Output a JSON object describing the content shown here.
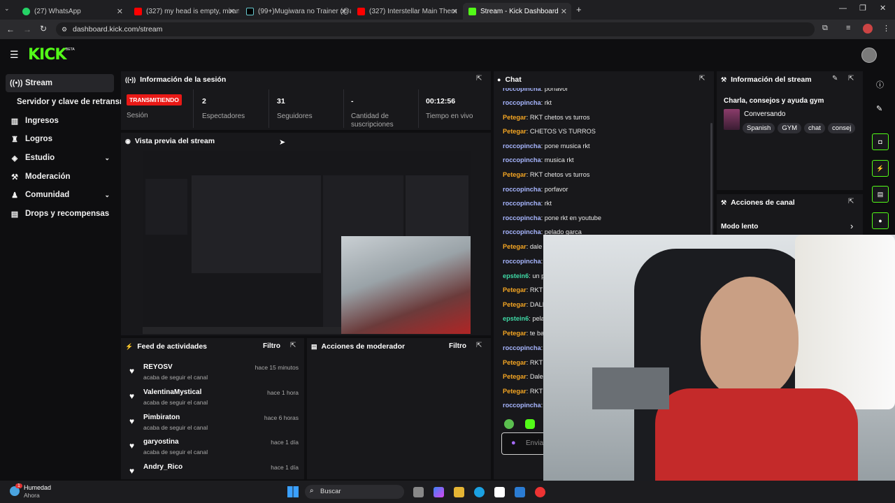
{
  "browser": {
    "tabs": [
      {
        "label": "(27) WhatsApp",
        "color": "#25d366"
      },
      {
        "label": "(327) my head is empty, mirand",
        "color": "#ff0000"
      },
      {
        "label": "(99+)Mugiwara no Trainer (@a",
        "color": "#000000"
      },
      {
        "label": "(327) Interstellar Main Them",
        "color": "#ff0000"
      },
      {
        "label": "Stream - Kick Dashboard",
        "color": "#53fc18"
      }
    ],
    "url": "dashboard.kick.com/stream"
  },
  "brand": {
    "logo": "KICK",
    "beta": "BETA",
    "accent": "#53fc18"
  },
  "sidebar": {
    "items": [
      {
        "label": "Stream",
        "icon": "broadcast-icon"
      },
      {
        "label": "Servidor y clave de retransm",
        "icon": ""
      },
      {
        "label": "Ingresos",
        "icon": "chart-icon"
      },
      {
        "label": "Logros",
        "icon": "trophy-icon"
      },
      {
        "label": "Estudio",
        "icon": "layers-icon"
      },
      {
        "label": "Moderación",
        "icon": "wrench-icon"
      },
      {
        "label": "Comunidad",
        "icon": "people-icon"
      },
      {
        "label": "Drops y recompensas",
        "icon": "gift-icon"
      }
    ]
  },
  "session": {
    "title": "Información de la sesión",
    "status_badge": "TRANSMITIENDO",
    "status_label": "Sesión",
    "stats": [
      {
        "value": "2",
        "label": "Espectadores"
      },
      {
        "value": "31",
        "label": "Seguidores"
      },
      {
        "value": "-",
        "label": "Cantidad de suscripciones"
      },
      {
        "value": "00:12:56",
        "label": "Tiempo en vivo"
      }
    ]
  },
  "preview": {
    "title": "Vista previa del stream"
  },
  "feed": {
    "title": "Feed de actividades",
    "filter": "Filtro",
    "rows": [
      {
        "name": "REYOSV",
        "sub": "acaba de seguir el canal",
        "time": "hace 15 minutos"
      },
      {
        "name": "ValentinaMystical",
        "sub": "acaba de seguir el canal",
        "time": "hace 1 hora"
      },
      {
        "name": "Pimbiraton",
        "sub": "acaba de seguir el canal",
        "time": "hace 6 horas"
      },
      {
        "name": "garyostina",
        "sub": "acaba de seguir el canal",
        "time": "hace 1 día"
      },
      {
        "name": "Andry_Rico",
        "sub": "",
        "time": "hace 1 día"
      }
    ]
  },
  "modactions": {
    "title": "Acciones de moderador",
    "filter": "Filtro"
  },
  "chat": {
    "title": "Chat",
    "input_placeholder": "Envia",
    "messages": [
      {
        "user": "roccopincha",
        "text": ": porfavor",
        "color": "#a7b6ff"
      },
      {
        "user": "roccopincha",
        "text": ": rkt",
        "color": "#a7b6ff"
      },
      {
        "user": "Petegar",
        "text": ": RKT chetos vs turros",
        "color": "#f5a623"
      },
      {
        "user": "Petegar",
        "text": ": CHETOS VS TURROS",
        "color": "#f5a623"
      },
      {
        "user": "roccopincha",
        "text": ": pone musica rkt",
        "color": "#a7b6ff"
      },
      {
        "user": "roccopincha",
        "text": ": musica rkt",
        "color": "#a7b6ff"
      },
      {
        "user": "Petegar",
        "text": ": RKT chetos vs turros",
        "color": "#f5a623"
      },
      {
        "user": "roccopincha",
        "text": ": porfavor",
        "color": "#a7b6ff"
      },
      {
        "user": "roccopincha",
        "text": ": rkt",
        "color": "#a7b6ff"
      },
      {
        "user": "roccopincha",
        "text": ": pone rkt en youtube",
        "color": "#a7b6ff"
      },
      {
        "user": "roccopincha",
        "text": ": pelado garca",
        "color": "#a7b6ff"
      },
      {
        "user": "Petegar",
        "text": ": dale",
        "color": "#f5a623"
      },
      {
        "user": "roccopincha",
        "text": ":",
        "color": "#a7b6ff"
      },
      {
        "user": "epstein6",
        "text": ": un p",
        "color": "#3fd9a6"
      },
      {
        "user": "Petegar",
        "text": ": RKT",
        "color": "#f5a623"
      },
      {
        "user": "Petegar",
        "text": ": DALE",
        "color": "#f5a623"
      },
      {
        "user": "epstein6",
        "text": ": pela",
        "color": "#3fd9a6"
      },
      {
        "user": "Petegar",
        "text": ": te ba",
        "color": "#f5a623"
      },
      {
        "user": "roccopincha",
        "text": ":",
        "color": "#a7b6ff"
      },
      {
        "user": "Petegar",
        "text": ": RKT",
        "color": "#f5a623"
      },
      {
        "user": "Petegar",
        "text": ": Dale",
        "color": "#f5a623"
      },
      {
        "user": "Petegar",
        "text": ": RKT",
        "color": "#f5a623"
      },
      {
        "user": "roccopincha",
        "text": ":",
        "color": "#a7b6ff"
      }
    ]
  },
  "streaminfo": {
    "title": "Información del stream",
    "stream_title": "Charla, consejos y ayuda gym",
    "category": "Conversando",
    "tags": [
      "Spanish",
      "GYM",
      "chat",
      "consej"
    ]
  },
  "channel_actions": {
    "title": "Acciones de canal",
    "slow_mode": "Modo lento"
  },
  "taskbar": {
    "weather": "Humedad",
    "weather_sub": "Ahora",
    "notif_count": "1",
    "search": "Buscar"
  }
}
